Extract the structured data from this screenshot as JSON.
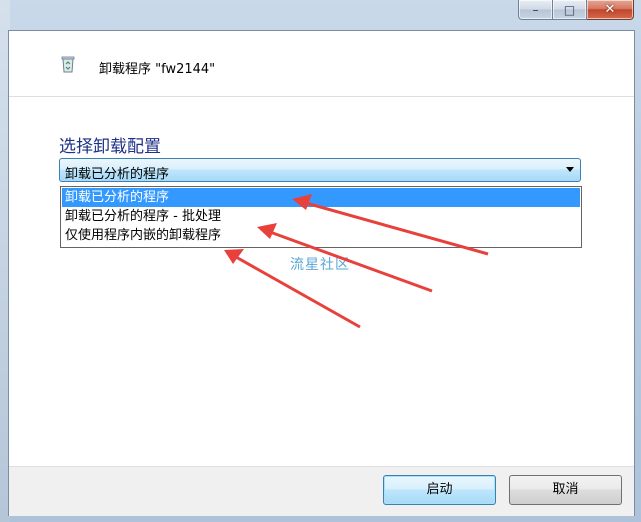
{
  "window": {
    "title_buttons": {
      "minimize": "–",
      "maximize": "□",
      "close": "✕"
    }
  },
  "header": {
    "title": "卸载程序 \"fw2144\"",
    "icon": "recycle-bin-icon"
  },
  "main": {
    "section_title": "选择卸载配置",
    "combo": {
      "selected": "卸载已分析的程序",
      "options": [
        "卸载已分析的程序",
        "卸载已分析的程序 - 批处理",
        "仅使用程序内嵌的卸载程序"
      ]
    },
    "watermark": "流星社区"
  },
  "footer": {
    "start_label": "启动",
    "cancel_label": "取消"
  },
  "colors": {
    "accent": "#3399ff",
    "annotation_arrow": "#e8413c"
  }
}
